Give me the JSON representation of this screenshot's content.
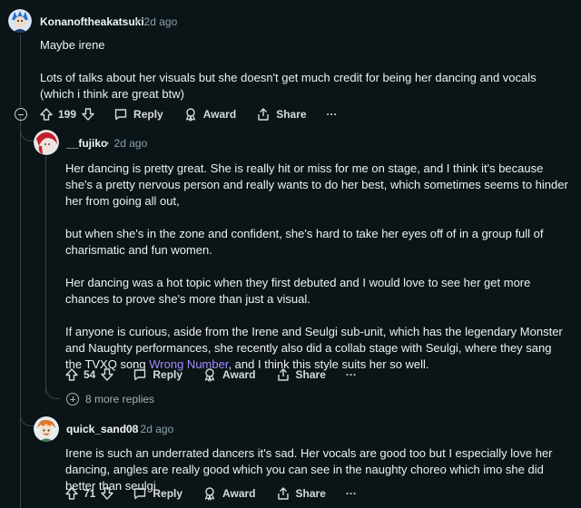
{
  "comments": [
    {
      "username": "Konanoftheakatsuki",
      "time": "2d ago",
      "paragraphs": [
        "Maybe irene",
        "Lots of talks about her visuals but she doesn't get much credit for being her dancing and vocals (which i think are great btw)"
      ],
      "votes": "199",
      "reply_label": "Reply",
      "award_label": "Award",
      "share_label": "Share",
      "more_label": "···"
    },
    {
      "username": "__fujiko",
      "time": "2d ago",
      "paragraphs": [
        "Her dancing is pretty great. She is really hit or miss for me on stage, and I think it's because she's a pretty nervous person and really wants to do her best, which sometimes seems to hinder her from going all out,",
        "but when she's in the zone and confident, she's hard to take her eyes off of in a group full of charismatic and fun women.",
        "Her dancing was a hot topic when they first debuted and I would love to see her get more chances to prove she's more than just a visual."
      ],
      "last_paragraph_before": "If anyone is curious, aside from the Irene and Seulgi sub-unit, which has the legendary Monster and Naughty performances, she recently also did a collab stage with Seulgi, where they sang the TVXQ song ",
      "last_paragraph_link": "Wrong Number",
      "last_paragraph_after": ", and I think this style suits her so well.",
      "votes": "54",
      "reply_label": "Reply",
      "award_label": "Award",
      "share_label": "Share",
      "more_label": "···"
    },
    {
      "username": "quick_sand08",
      "time": "2d ago",
      "paragraphs": [
        "Irene is such an underrated dancers it's sad. Her vocals are good too but I especially love her dancing, angles are really good which you can see in the naughty choreo which imo she did better than seulgi"
      ],
      "votes": "71",
      "reply_label": "Reply",
      "award_label": "Award",
      "share_label": "Share",
      "more_label": "···"
    }
  ],
  "more_replies": "8 more replies",
  "separator": "•",
  "colors": {
    "background": "#0b1416",
    "text": "#eef1f3",
    "meta": "#8ba2ad",
    "link": "#a08bff",
    "thread_line": "#3a4447"
  },
  "icons": [
    "upvote-icon",
    "downvote-icon",
    "comment-icon",
    "award-icon",
    "share-icon",
    "collapse-icon",
    "expand-icon"
  ]
}
